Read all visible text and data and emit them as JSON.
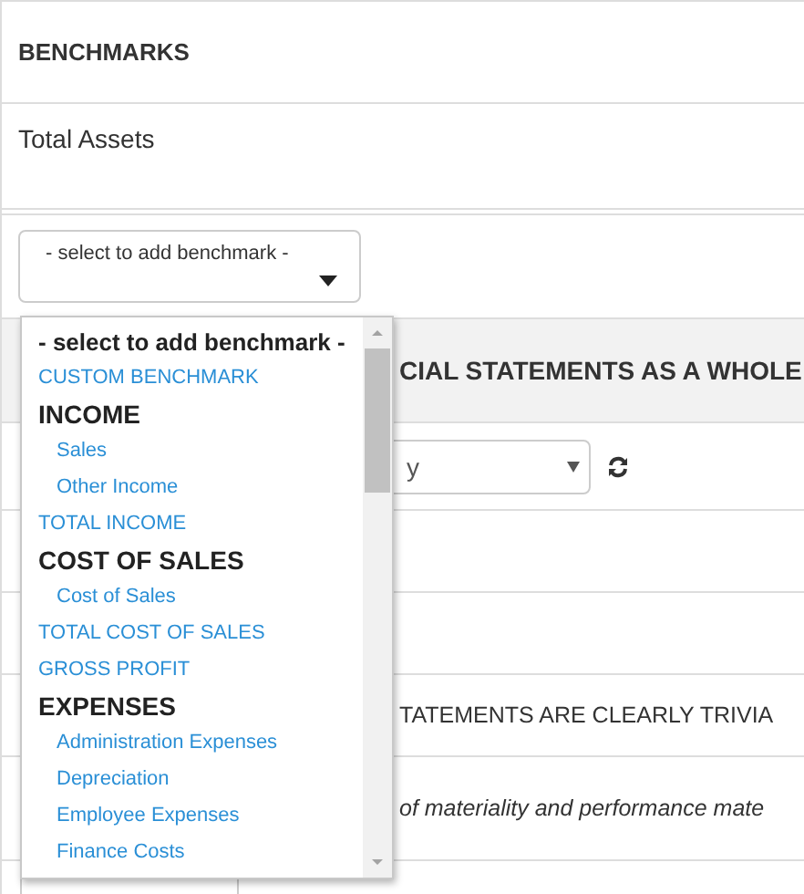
{
  "section": {
    "title": "BENCHMARKS"
  },
  "benchmark": {
    "name": "Total Assets"
  },
  "benchmark_select": {
    "value": "- select to add benchmark -",
    "expanded": true,
    "options": [
      {
        "kind": "placeholder",
        "label": "- select to add benchmark -"
      },
      {
        "kind": "option",
        "label": "CUSTOM BENCHMARK"
      },
      {
        "kind": "group",
        "label": "INCOME"
      },
      {
        "kind": "child",
        "label": "Sales"
      },
      {
        "kind": "child",
        "label": "Other Income"
      },
      {
        "kind": "option",
        "label": "TOTAL INCOME"
      },
      {
        "kind": "group",
        "label": "COST OF SALES"
      },
      {
        "kind": "child",
        "label": "Cost of Sales"
      },
      {
        "kind": "option",
        "label": "TOTAL COST OF SALES"
      },
      {
        "kind": "option",
        "label": "GROSS PROFIT"
      },
      {
        "kind": "group",
        "label": "EXPENSES"
      },
      {
        "kind": "child",
        "label": "Administration Expenses"
      },
      {
        "kind": "child",
        "label": "Depreciation"
      },
      {
        "kind": "child",
        "label": "Employee Expenses"
      },
      {
        "kind": "child",
        "label": "Finance Costs"
      }
    ]
  },
  "section_header": {
    "title": "CIAL STATEMENTS AS A WHOLE"
  },
  "basis_select": {
    "value": "y"
  },
  "trivial_heading": "TATEMENTS ARE CLEARLY TRIVIA",
  "note": "of materiality and performance mate"
}
